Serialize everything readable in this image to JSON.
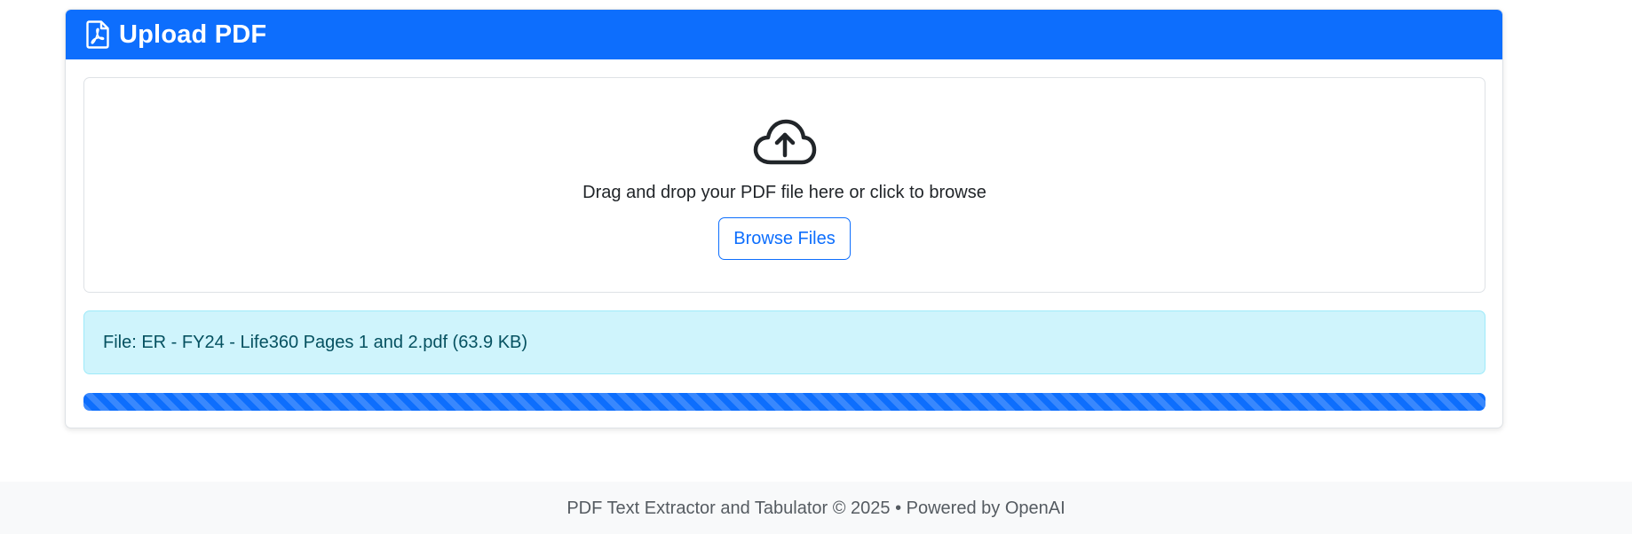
{
  "card": {
    "title": "Upload PDF",
    "title_icon": "file-pdf-icon"
  },
  "dropzone": {
    "icon": "cloud-upload-icon",
    "instruction": "Drag and drop your PDF file here or click to browse",
    "browse_label": "Browse Files"
  },
  "file_info": {
    "text": "File: ER - FY24 - Life360 Pages 1 and 2.pdf (63.9 KB)"
  },
  "progress": {
    "value_percent": 100,
    "style": "striped"
  },
  "footer": {
    "text": "PDF Text Extractor and Tabulator © 2025 • Powered by OpenAI"
  },
  "colors": {
    "primary": "#0d6efd",
    "info_bg": "#cff4fc",
    "info_text": "#055160",
    "footer_bg": "#f8f9fa"
  }
}
